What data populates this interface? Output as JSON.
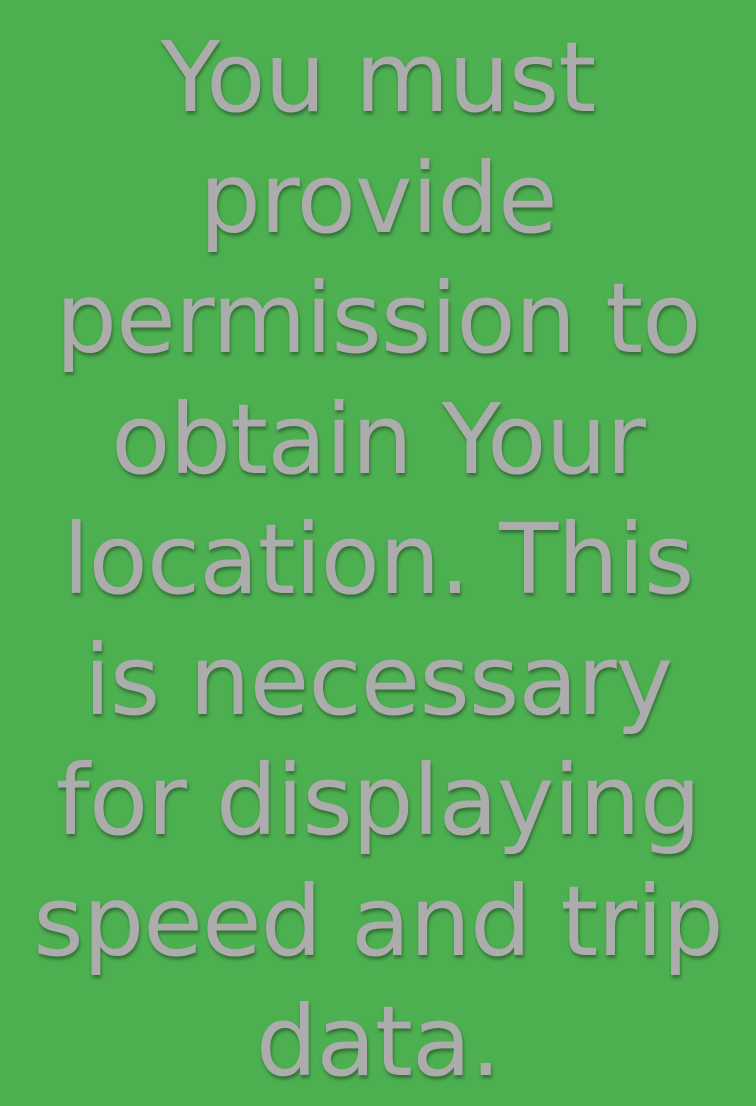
{
  "screen": {
    "background_color": "#4caf50",
    "text_color": "#acacac",
    "message": "You must provide permission to obtain Your location. This is necessary for displaying speed and trip data."
  }
}
